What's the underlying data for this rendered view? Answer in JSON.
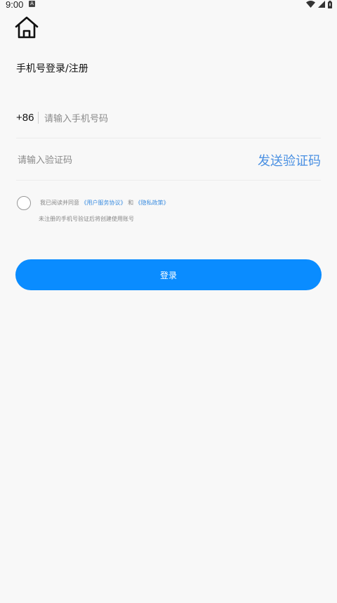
{
  "status_bar": {
    "time": "9:00",
    "notification_badge": "A",
    "icons": [
      "wifi-icon",
      "signal-icon",
      "battery-icon"
    ]
  },
  "header": {
    "home_icon": "home-icon",
    "title": "手机号登录/注册"
  },
  "phone": {
    "country_code": "+86",
    "placeholder": "请输入手机号码",
    "value": ""
  },
  "verification": {
    "placeholder": "请输入验证码",
    "value": "",
    "send_label": "发送验证码"
  },
  "agreement": {
    "checked": false,
    "prefix": "我已阅读并同意",
    "user_agreement": "《用户服务协议》",
    "conjunction": "和",
    "privacy_policy": "《隐私政策》",
    "note": "未注册的手机号验证后将创建使用账号"
  },
  "login": {
    "label": "登录"
  },
  "colors": {
    "accent": "#0a8cff",
    "link": "#3b8de0",
    "send_code": "#4a90e2",
    "background": "#f8f8f8"
  }
}
